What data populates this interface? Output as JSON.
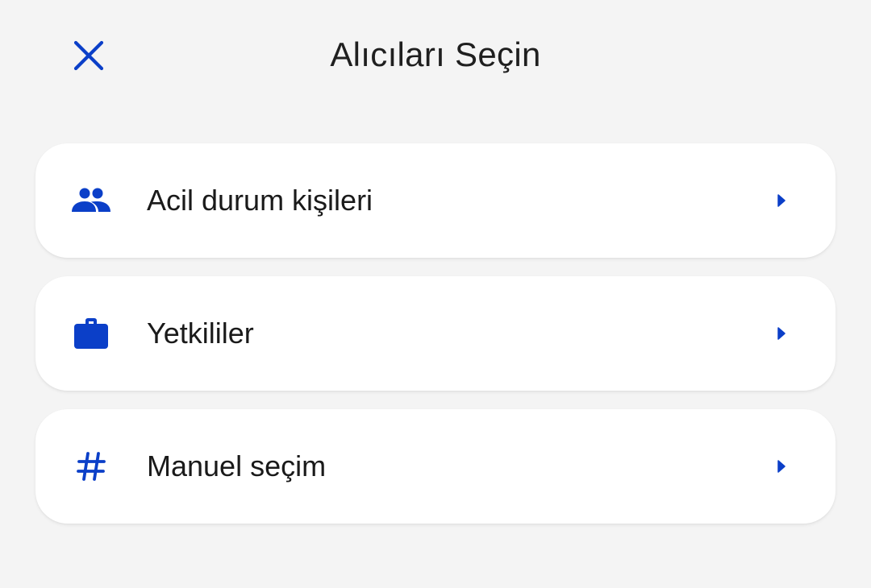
{
  "header": {
    "title": "Alıcıları Seçin",
    "close_icon": "close-icon"
  },
  "colors": {
    "accent": "#0b3fc8",
    "background": "#f4f4f4",
    "card": "#ffffff",
    "text": "#1a1a1a"
  },
  "options": [
    {
      "label": "Acil durum kişileri",
      "icon": "group-icon"
    },
    {
      "label": "Yetkililer",
      "icon": "briefcase-icon"
    },
    {
      "label": "Manuel seçim",
      "icon": "hash-icon"
    }
  ]
}
